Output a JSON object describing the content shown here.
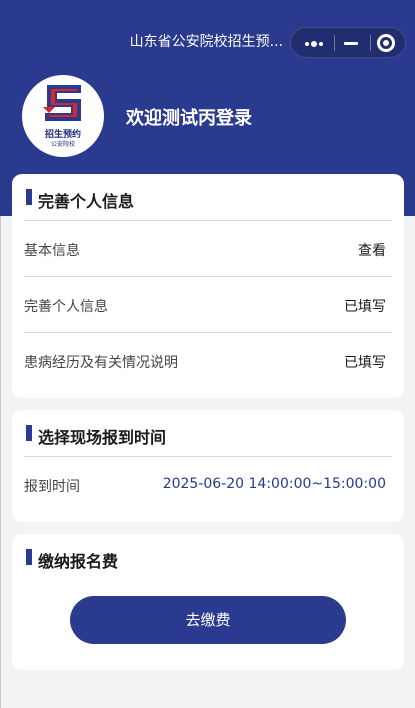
{
  "nav": {
    "title": "山东省公安院校招生预...",
    "menu_icon": "more-dots-icon",
    "minimize_icon": "minimize-icon",
    "close_icon": "target-close-icon"
  },
  "profile": {
    "logo_text_1": "招生预约",
    "logo_text_2": "公安院校",
    "welcome": "欢迎测试丙登录"
  },
  "personal_info": {
    "title": "完善个人信息",
    "rows": [
      {
        "label": "基本信息",
        "value": "查看"
      },
      {
        "label": "完善个人信息",
        "value": "已填写"
      },
      {
        "label": "患病经历及有关情况说明",
        "value": "已填写"
      }
    ]
  },
  "report_time": {
    "title": "选择现场报到时间",
    "label": "报到时间",
    "value": "2025-06-20 14:00:00~15:00:00"
  },
  "payment": {
    "title": "缴纳报名费",
    "button": "去缴费"
  },
  "colors": {
    "brand": "#2a3a8f",
    "background": "#f2f3f5",
    "logo_red": "#d7262e"
  }
}
